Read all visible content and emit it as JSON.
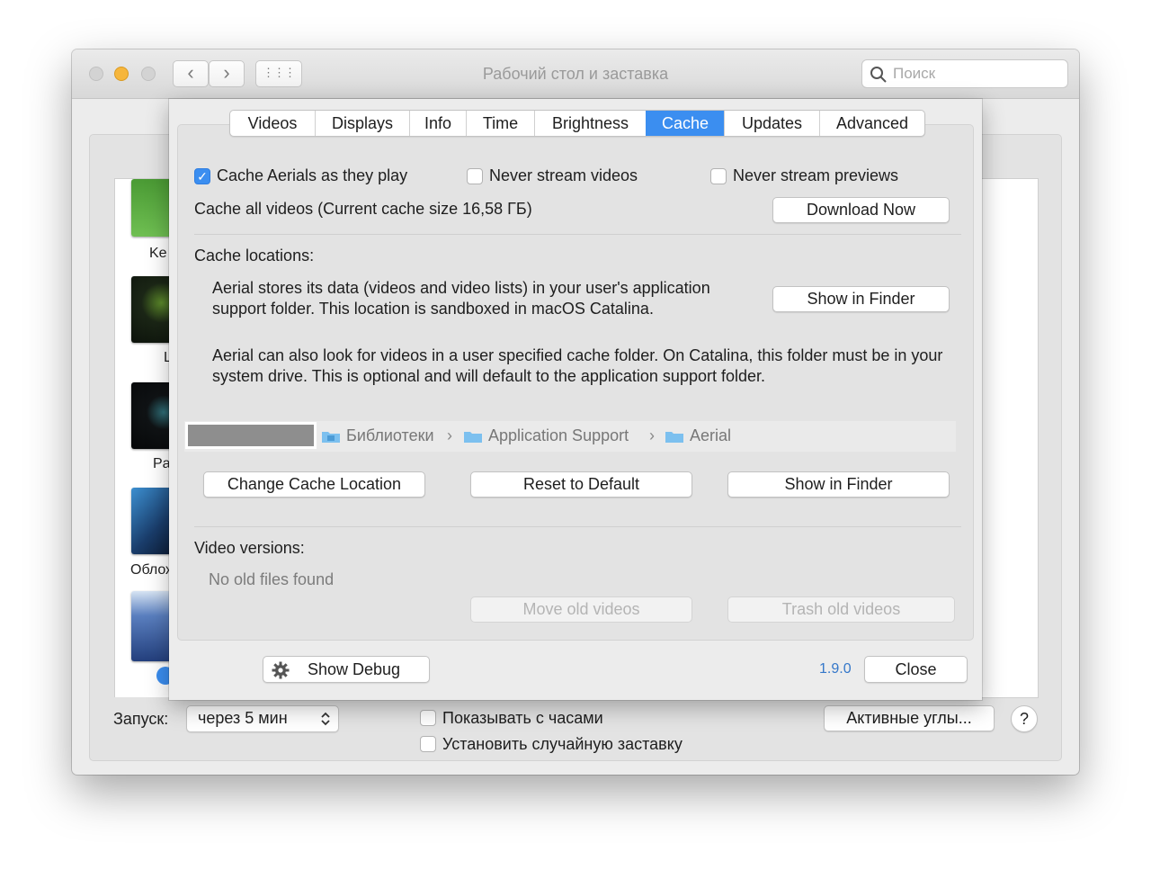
{
  "window": {
    "title": "Рабочий стол и заставка",
    "search_placeholder": "Поиск",
    "nav": {
      "back": "‹",
      "forward": "›",
      "grid": "⋮⋮⋮"
    }
  },
  "screensaver_list": {
    "items": [
      {
        "label": "Ke",
        "color": "#4f9a3a"
      },
      {
        "label": "L",
        "color": "#1d2a1a"
      },
      {
        "label": "Pa",
        "color": "#0b0d0e"
      },
      {
        "label": "Облож",
        "color": "#2b6aa8"
      },
      {
        "label": "",
        "color": "#2e4e8c"
      }
    ]
  },
  "bottom": {
    "start_label": "Запуск:",
    "start_value": "через 5 мин",
    "show_clock_label": "Показывать с часами",
    "random_saver_label": "Установить случайную заставку",
    "hot_corners_button": "Активные углы...",
    "help_button": "?"
  },
  "aerial": {
    "tabs": [
      {
        "label": "Videos",
        "active": false
      },
      {
        "label": "Displays",
        "active": false
      },
      {
        "label": "Info",
        "active": false
      },
      {
        "label": "Time",
        "active": false
      },
      {
        "label": "Brightness",
        "active": false
      },
      {
        "label": "Cache",
        "active": true
      },
      {
        "label": "Updates",
        "active": false
      },
      {
        "label": "Advanced",
        "active": false
      }
    ],
    "cache": {
      "cache_as_play_label": "Cache Aerials as they play",
      "cache_as_play_checked": true,
      "never_stream_videos_label": "Never stream videos",
      "never_stream_videos_checked": false,
      "never_stream_previews_label": "Never stream previews",
      "never_stream_previews_checked": false,
      "cache_all_text": "Cache all videos (Current cache size 16,58 ГБ)",
      "download_now_button": "Download Now"
    },
    "locations": {
      "heading": "Cache locations:",
      "para1": "Aerial stores its data (videos and video lists) in your user's application support folder. This location is sandboxed in macOS Catalina.",
      "show_in_finder_button": "Show in Finder",
      "para2": "Aerial can also look for videos in a user specified cache folder. On Catalina, this folder must be in your system drive. This is optional and will default to the application support folder.",
      "path": [
        "Библиотеки",
        "Application Support",
        "Aerial"
      ],
      "path_separator": "›",
      "change_button": "Change Cache Location",
      "reset_button": "Reset to Default",
      "show_in_finder_button2": "Show in Finder"
    },
    "versions": {
      "heading": "Video versions:",
      "status": "No old files found",
      "move_button": "Move old videos",
      "trash_button": "Trash old videos"
    },
    "footer": {
      "debug_button": "Show Debug",
      "version": "1.9.0",
      "close_button": "Close"
    },
    "accent_color": "#3b8ef0"
  }
}
